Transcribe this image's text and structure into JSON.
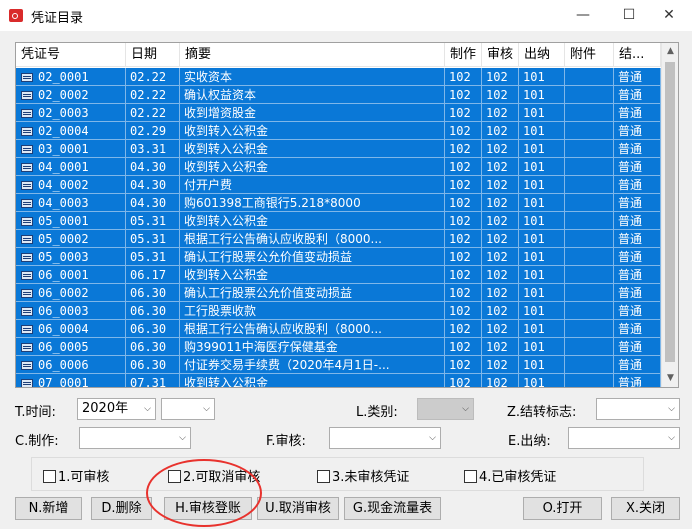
{
  "window": {
    "title": "凭证目录",
    "minimize_icon": "minimize-icon",
    "maximize_icon": "maximize-icon",
    "close_icon": "close-icon"
  },
  "table": {
    "columns": [
      "凭证号",
      "日期",
      "摘要",
      "制作",
      "审核",
      "出纳",
      "附件",
      "结..."
    ],
    "rows": [
      [
        "02_0001",
        "02.22",
        "实收资本",
        "102",
        "102",
        "101",
        "",
        "普通"
      ],
      [
        "02_0002",
        "02.22",
        "确认权益资本",
        "102",
        "102",
        "101",
        "",
        "普通"
      ],
      [
        "02_0003",
        "02.22",
        "收到增资股金",
        "102",
        "102",
        "101",
        "",
        "普通"
      ],
      [
        "02_0004",
        "02.29",
        "收到转入公积金",
        "102",
        "102",
        "101",
        "",
        "普通"
      ],
      [
        "03_0001",
        "03.31",
        "收到转入公积金",
        "102",
        "102",
        "101",
        "",
        "普通"
      ],
      [
        "04_0001",
        "04.30",
        "收到转入公积金",
        "102",
        "102",
        "101",
        "",
        "普通"
      ],
      [
        "04_0002",
        "04.30",
        "付开户费",
        "102",
        "102",
        "101",
        "",
        "普通"
      ],
      [
        "04_0003",
        "04.30",
        "购601398工商银行5.218*8000",
        "102",
        "102",
        "101",
        "",
        "普通"
      ],
      [
        "05_0001",
        "05.31",
        "收到转入公积金",
        "102",
        "102",
        "101",
        "",
        "普通"
      ],
      [
        "05_0002",
        "05.31",
        "根据工行公告确认应收股利（8000...",
        "102",
        "102",
        "101",
        "",
        "普通"
      ],
      [
        "05_0003",
        "05.31",
        "确认工行股票公允价值变动损益",
        "102",
        "102",
        "101",
        "",
        "普通"
      ],
      [
        "06_0001",
        "06.17",
        "收到转入公积金",
        "102",
        "102",
        "101",
        "",
        "普通"
      ],
      [
        "06_0002",
        "06.30",
        "确认工行股票公允价值变动损益",
        "102",
        "102",
        "101",
        "",
        "普通"
      ],
      [
        "06_0003",
        "06.30",
        "工行股票收款",
        "102",
        "102",
        "101",
        "",
        "普通"
      ],
      [
        "06_0004",
        "06.30",
        "根据工行公告确认应收股利（8000...",
        "102",
        "102",
        "101",
        "",
        "普通"
      ],
      [
        "06_0005",
        "06.30",
        "购399011中海医疗保健基金",
        "102",
        "102",
        "101",
        "",
        "普通"
      ],
      [
        "06_0006",
        "06.30",
        "付证券交易手续费（2020年4月1日-...",
        "102",
        "102",
        "101",
        "",
        "普通"
      ],
      [
        "07_0001",
        "07.31",
        "收到转入公积金",
        "102",
        "102",
        "101",
        "",
        "普通"
      ]
    ]
  },
  "filters": {
    "time_label": "T.时间:",
    "time_year": "2020年",
    "time_month": "",
    "category_label": "L.类别:",
    "category_value": "",
    "carry_label": "Z.结转标志:",
    "carry_value": "",
    "maker_label": "C.制作:",
    "maker_value": "",
    "reviewer_label": "F.审核:",
    "reviewer_value": "",
    "cashier_label": "E.出纳:",
    "cashier_value": ""
  },
  "options": [
    "1.可审核",
    "2.可取消审核",
    "3.未审核凭证",
    "4.已审核凭证"
  ],
  "buttons": {
    "new": "N.新增",
    "delete": "D.删除",
    "review": "H.审核登账",
    "unreview": "U.取消审核",
    "cashflow": "G.现金流量表",
    "open": "O.打开",
    "close": "X.关闭"
  },
  "colors": {
    "selection": "#0a78d7",
    "annotation": "#e8322d"
  }
}
